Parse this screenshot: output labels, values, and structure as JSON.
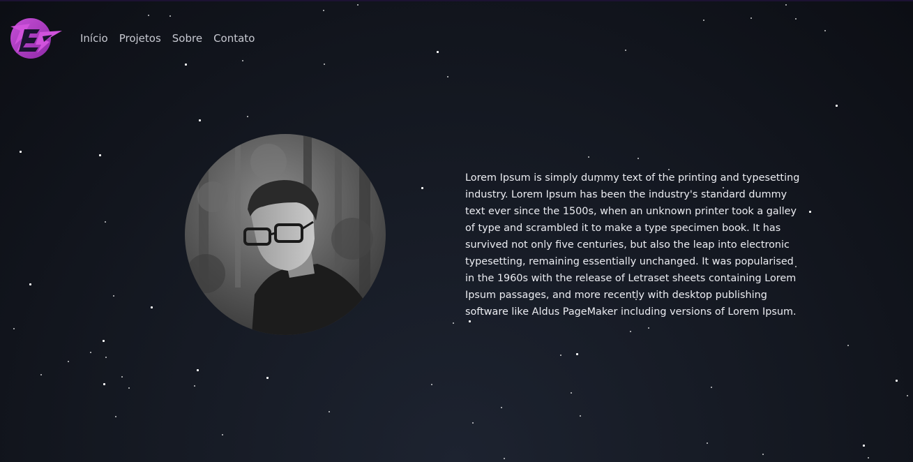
{
  "colors": {
    "background": "#141821",
    "accent": "#b63fc9",
    "text": "#ecedf2",
    "nav_text": "#c8cad2"
  },
  "header": {
    "logo_icon": "lightning-monogram-logo",
    "nav": [
      {
        "label": "Início"
      },
      {
        "label": "Projetos"
      },
      {
        "label": "Sobre"
      },
      {
        "label": "Contato"
      }
    ]
  },
  "main": {
    "avatar": "profile-photo-grayscale",
    "bio": "Lorem Ipsum is simply dummy text of the printing and typesetting industry. Lorem Ipsum has been the industry's standard dummy text ever since the 1500s, when an unknown printer took a galley of type and scrambled it to make a type specimen book. It has survived not only five centuries, but also the leap into electronic typesetting, remaining essentially unchanged. It was popularised in the 1960s with the release of Letraset sheets containing Lorem Ipsum passages, and more recently with desktop publishing software like Aldus PageMaker including versions of Lorem Ipsum."
  }
}
